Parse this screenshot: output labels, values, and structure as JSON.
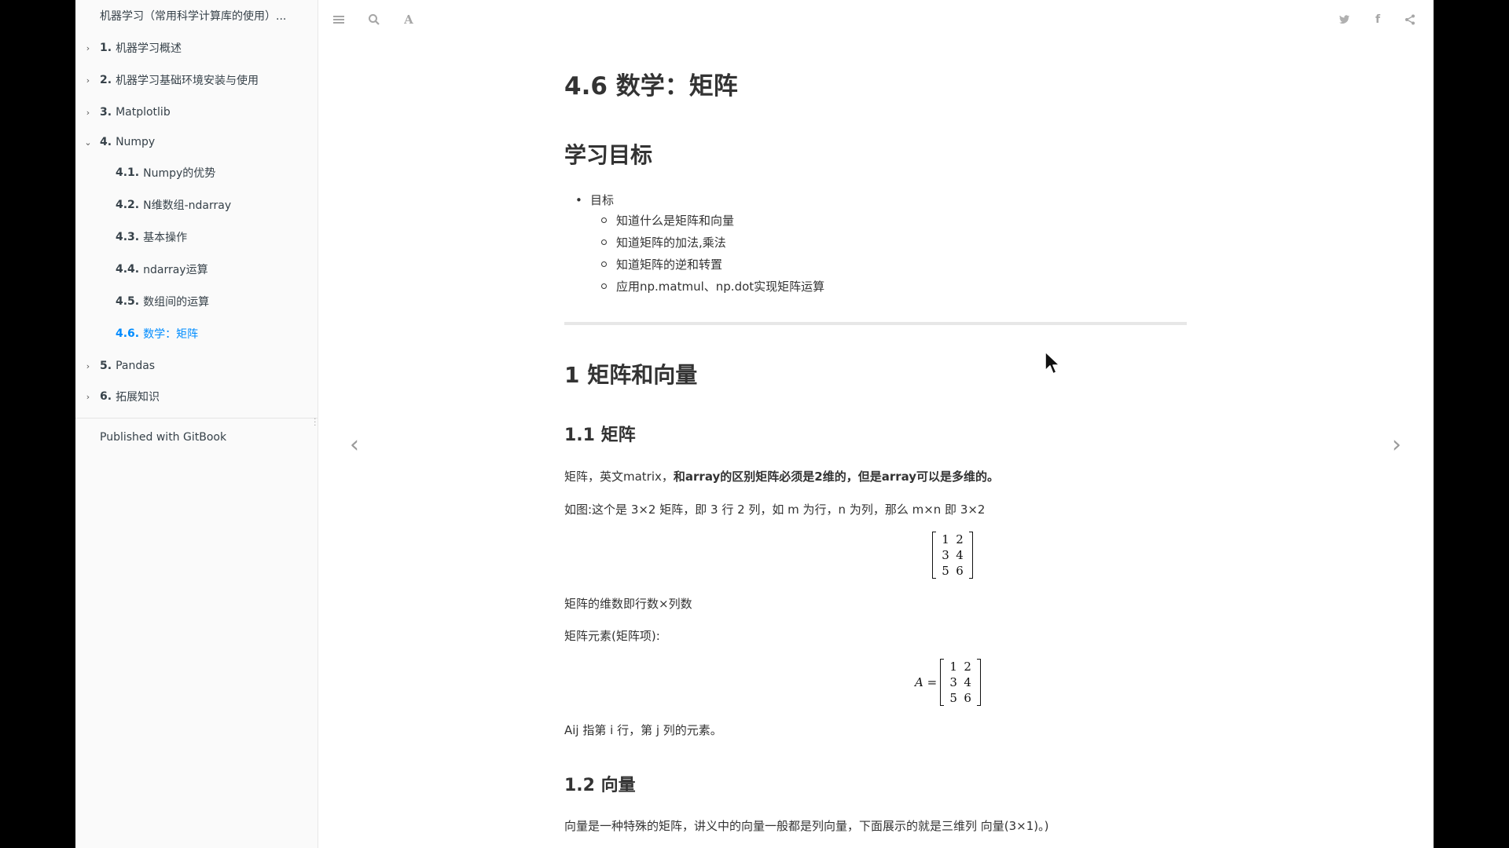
{
  "sidebar": {
    "book_title": "机器学习（常用科学计算库的使用）...",
    "items": [
      {
        "num": "1.",
        "label": "机器学习概述",
        "chevron": "›"
      },
      {
        "num": "2.",
        "label": "机器学习基础环境安装与使用",
        "chevron": "›"
      },
      {
        "num": "3.",
        "label": "Matplotlib",
        "chevron": "›"
      },
      {
        "num": "4.",
        "label": "Numpy",
        "chevron": "⌄"
      },
      {
        "num": "4.1.",
        "label": "Numpy的优势"
      },
      {
        "num": "4.2.",
        "label": "N维数组-ndarray"
      },
      {
        "num": "4.3.",
        "label": "基本操作"
      },
      {
        "num": "4.4.",
        "label": "ndarray运算"
      },
      {
        "num": "4.5.",
        "label": "数组间的运算"
      },
      {
        "num": "4.6.",
        "label": "数学：矩阵"
      },
      {
        "num": "5.",
        "label": "Pandas",
        "chevron": "›"
      },
      {
        "num": "6.",
        "label": "拓展知识",
        "chevron": "›"
      }
    ],
    "published": "Published with GitBook"
  },
  "toolbar": {
    "left_icons": [
      "menu-icon",
      "search-icon",
      "font-settings-icon"
    ],
    "right_icons": [
      "twitter-icon",
      "facebook-icon",
      "share-icon"
    ]
  },
  "page": {
    "title": "4.6 数学：矩阵",
    "section_goals": "学习目标",
    "goals_label": "目标",
    "goals": [
      "知道什么是矩阵和向量",
      "知道矩阵的加法,乘法",
      "知道矩阵的逆和转置",
      "应用np.matmul、np.dot实现矩阵运算"
    ],
    "h2_matrix_vector": "1 矩阵和向量",
    "h3_matrix": "1.1 矩阵",
    "p_matrix_intro_a": "矩阵，英文matrix，",
    "p_matrix_intro_b": "和array的区别矩阵必须是2维的，但是array可以是多维的。",
    "p_matrix_example": "如图:这个是 3×2 矩阵，即 3 行 2 列，如 m 为行，n 为列，那么 m×n 即 3×2",
    "matrix1": [
      "1",
      "2",
      "3",
      "4",
      "5",
      "6"
    ],
    "p_dims": "矩阵的维数即行数×列数",
    "p_elements": "矩阵元素(矩阵项):",
    "matrix2_label": "A =",
    "matrix2": [
      "1",
      "2",
      "3",
      "4",
      "5",
      "6"
    ],
    "p_aij": "Aij 指第 i 行，第 j 列的元素。",
    "h3_vector": "1.2 向量",
    "p_vector": "向量是一种特殊的矩阵，讲义中的向量一般都是列向量，下面展示的就是三维列 向量(3×1)。)"
  },
  "nav": {
    "prev": "‹",
    "next": "›"
  },
  "colors": {
    "active_link": "#008cff",
    "sidebar_bg": "#fafafa",
    "text": "#333333"
  }
}
